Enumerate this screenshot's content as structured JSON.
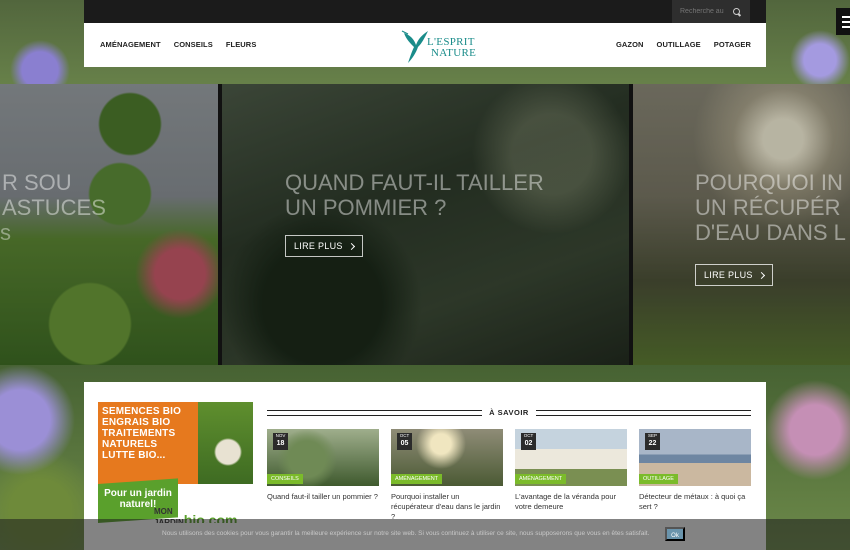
{
  "header": {
    "search_placeholder": "Recherche au",
    "nav_left": [
      "AMÉNAGEMENT",
      "CONSEILS",
      "FLEURS"
    ],
    "nav_right": [
      "GAZON",
      "OUTILLAGE",
      "POTAGER"
    ],
    "logo_line1": "L'ESPRIT",
    "logo_line2": "NATURE"
  },
  "slider": {
    "slides": [
      {
        "title": "R SOU\nASTUCES",
        "side": "s"
      },
      {
        "title": "QUAND FAUT-IL TAILLER\nUN POMMIER ?",
        "cta": "LIRE PLUS"
      },
      {
        "title": "POURQUOI IN\nUN RÉCUPÉR\nD'EAU DANS L",
        "cta": "LIRE PLUS"
      }
    ]
  },
  "ad": {
    "lines": [
      "SEMENCES BIO",
      "ENGRAIS BIO",
      "TRAITEMENTS",
      "NATURELS",
      "LUTTE BIO..."
    ],
    "slogan": "Pour un jardin naturel!",
    "brand_prefix": "MON\nJARDIN",
    "brand": "bio.com"
  },
  "section": {
    "title": "À SAVOIR"
  },
  "cards": [
    {
      "month": "NOV",
      "day": "18",
      "category": "CONSEILS",
      "title": "Quand faut-il tailler un pommier ?"
    },
    {
      "month": "OCT",
      "day": "05",
      "category": "AMÉNAGEMENT",
      "title": "Pourquoi installer un récupérateur d'eau dans le jardin ?"
    },
    {
      "month": "OCT",
      "day": "02",
      "category": "AMÉNAGEMENT",
      "title": "L'avantage de la véranda pour votre demeure"
    },
    {
      "month": "SEP",
      "day": "22",
      "category": "OUTILLAGE",
      "title": "Détecteur de métaux : à quoi ça sert ?"
    }
  ],
  "cookie": {
    "text": "Nous utilisons des cookies pour vous garantir la meilleure expérience sur notre site web. Si vous continuez à utiliser ce site, nous supposerons que vous en êtes satisfait.",
    "ok": "Ok"
  },
  "colors": {
    "accent": "#7bbb2a",
    "logo": "#1a8c8a",
    "ad_orange": "#e6791e"
  }
}
